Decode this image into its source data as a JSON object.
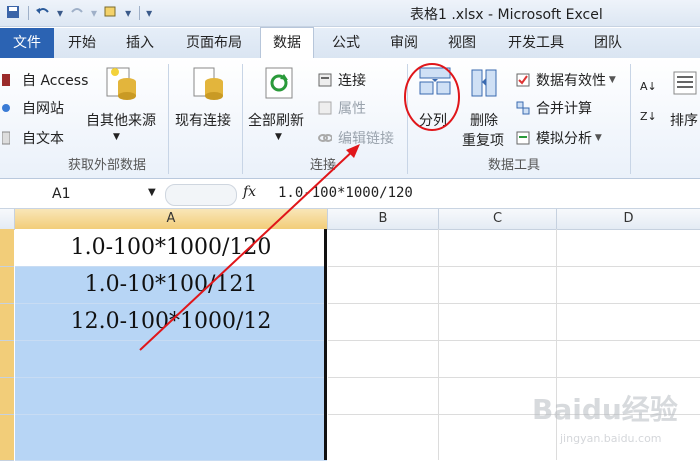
{
  "title_bar": {
    "title": "表格1 .xlsx - Microsoft Excel"
  },
  "tabs": [
    {
      "label": "文件"
    },
    {
      "label": "开始"
    },
    {
      "label": "插入"
    },
    {
      "label": "页面布局"
    },
    {
      "label": "数据"
    },
    {
      "label": "公式"
    },
    {
      "label": "审阅"
    },
    {
      "label": "视图"
    },
    {
      "label": "开发工具"
    },
    {
      "label": "团队"
    }
  ],
  "ribbon": {
    "external": {
      "from_access": "自 Access",
      "from_web": "自网站",
      "from_text": "自文本",
      "other_sources": "自其他来源",
      "existing_conn": "现有连接",
      "group_label": "获取外部数据"
    },
    "connections": {
      "refresh_all": "全部刷新",
      "connections": "连接",
      "properties": "属性",
      "edit_links": "编辑链接",
      "group_label": "连接"
    },
    "data_tools": {
      "split": "分列",
      "remove_dup_1": "删除",
      "remove_dup_2": "重复项",
      "validation": "数据有效性",
      "consolidate": "合并计算",
      "whatif": "模拟分析",
      "group_label": "数据工具"
    },
    "sort": {
      "sort": "排序"
    }
  },
  "formula_bar": {
    "name_box": "A1",
    "fx": "fx",
    "content": "1.0-100*1000/120"
  },
  "columns": [
    "A",
    "B",
    "C",
    "D"
  ],
  "cells": [
    "1.0-100*1000/120",
    "1.0-10*100/121",
    "12.0-100*1000/12"
  ],
  "watermark": {
    "logo": "Baidu经验",
    "url": "jingyan.baidu.com"
  },
  "colors": {
    "accent": "#2b63b3",
    "selection": "#b7d5f5",
    "annotation": "#e0161a"
  }
}
